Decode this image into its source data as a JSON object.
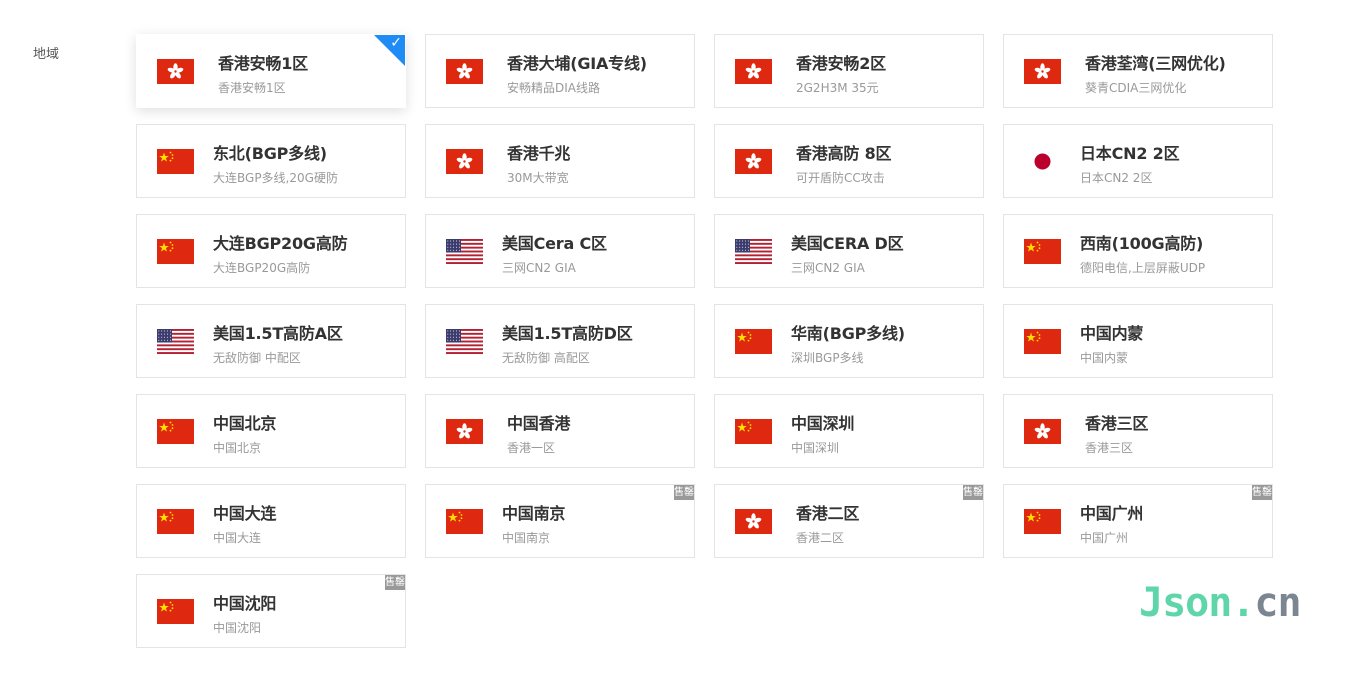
{
  "region_label": "地域",
  "colors": {
    "accent": "#1f8bf5",
    "card_border": "#e4e4e4",
    "badge": "#999999",
    "watermark_green": "#5fd6a9",
    "watermark_gray": "#7b8690"
  },
  "regions": [
    {
      "title": "香港安畅1区",
      "subtitle": "香港安畅1区",
      "flag": "hk-flag-icon",
      "selected": true,
      "badge": ""
    },
    {
      "title": "香港大埔(GIA专线)",
      "subtitle": "安畅精品DIA线路",
      "flag": "hk-flag-icon",
      "selected": false,
      "badge": ""
    },
    {
      "title": "香港安畅2区",
      "subtitle": "2G2H3M 35元",
      "flag": "hk-flag-icon",
      "selected": false,
      "badge": ""
    },
    {
      "title": "香港荃湾(三网优化)",
      "subtitle": "葵青CDIA三网优化",
      "flag": "hk-flag-icon",
      "selected": false,
      "badge": ""
    },
    {
      "title": "东北(BGP多线)",
      "subtitle": "大连BGP多线,20G硬防",
      "flag": "cn-flag-icon",
      "selected": false,
      "badge": ""
    },
    {
      "title": "香港千兆",
      "subtitle": "30M大带宽",
      "flag": "hk-flag-icon",
      "selected": false,
      "badge": ""
    },
    {
      "title": "香港高防 8区",
      "subtitle": "可开盾防CC攻击",
      "flag": "hk-flag-icon",
      "selected": false,
      "badge": ""
    },
    {
      "title": "日本CN2 2区",
      "subtitle": "日本CN2 2区",
      "flag": "jp-flag-icon",
      "selected": false,
      "badge": ""
    },
    {
      "title": "大连BGP20G高防",
      "subtitle": "大连BGP20G高防",
      "flag": "cn-flag-icon",
      "selected": false,
      "badge": ""
    },
    {
      "title": "美国Cera C区",
      "subtitle": "三网CN2 GIA",
      "flag": "us-flag-icon",
      "selected": false,
      "badge": ""
    },
    {
      "title": "美国CERA D区",
      "subtitle": "三网CN2 GIA",
      "flag": "us-flag-icon",
      "selected": false,
      "badge": ""
    },
    {
      "title": "西南(100G高防)",
      "subtitle": "德阳电信,上层屏蔽UDP",
      "flag": "cn-flag-icon",
      "selected": false,
      "badge": ""
    },
    {
      "title": "美国1.5T高防A区",
      "subtitle": "无敌防御 中配区",
      "flag": "us-flag-icon",
      "selected": false,
      "badge": ""
    },
    {
      "title": "美国1.5T高防D区",
      "subtitle": "无敌防御 高配区",
      "flag": "us-flag-icon",
      "selected": false,
      "badge": ""
    },
    {
      "title": "华南(BGP多线)",
      "subtitle": "深圳BGP多线",
      "flag": "cn-flag-icon",
      "selected": false,
      "badge": ""
    },
    {
      "title": "中国内蒙",
      "subtitle": "中国内蒙",
      "flag": "cn-flag-icon",
      "selected": false,
      "badge": ""
    },
    {
      "title": "中国北京",
      "subtitle": "中国北京",
      "flag": "cn-flag-icon",
      "selected": false,
      "badge": ""
    },
    {
      "title": "中国香港",
      "subtitle": "香港一区",
      "flag": "hk-flag-icon",
      "selected": false,
      "badge": ""
    },
    {
      "title": "中国深圳",
      "subtitle": "中国深圳",
      "flag": "cn-flag-icon",
      "selected": false,
      "badge": ""
    },
    {
      "title": "香港三区",
      "subtitle": "香港三区",
      "flag": "hk-flag-icon",
      "selected": false,
      "badge": ""
    },
    {
      "title": "中国大连",
      "subtitle": "中国大连",
      "flag": "cn-flag-icon",
      "selected": false,
      "badge": ""
    },
    {
      "title": "中国南京",
      "subtitle": "中国南京",
      "flag": "cn-flag-icon",
      "selected": false,
      "badge": "售罄"
    },
    {
      "title": "香港二区",
      "subtitle": "香港二区",
      "flag": "hk-flag-icon",
      "selected": false,
      "badge": "售罄"
    },
    {
      "title": "中国广州",
      "subtitle": "中国广州",
      "flag": "cn-flag-icon",
      "selected": false,
      "badge": "售罄"
    },
    {
      "title": "中国沈阳",
      "subtitle": "中国沈阳",
      "flag": "cn-flag-icon",
      "selected": false,
      "badge": "售罄"
    }
  ],
  "watermark": {
    "part1": "Json.",
    "part2": "cn"
  }
}
